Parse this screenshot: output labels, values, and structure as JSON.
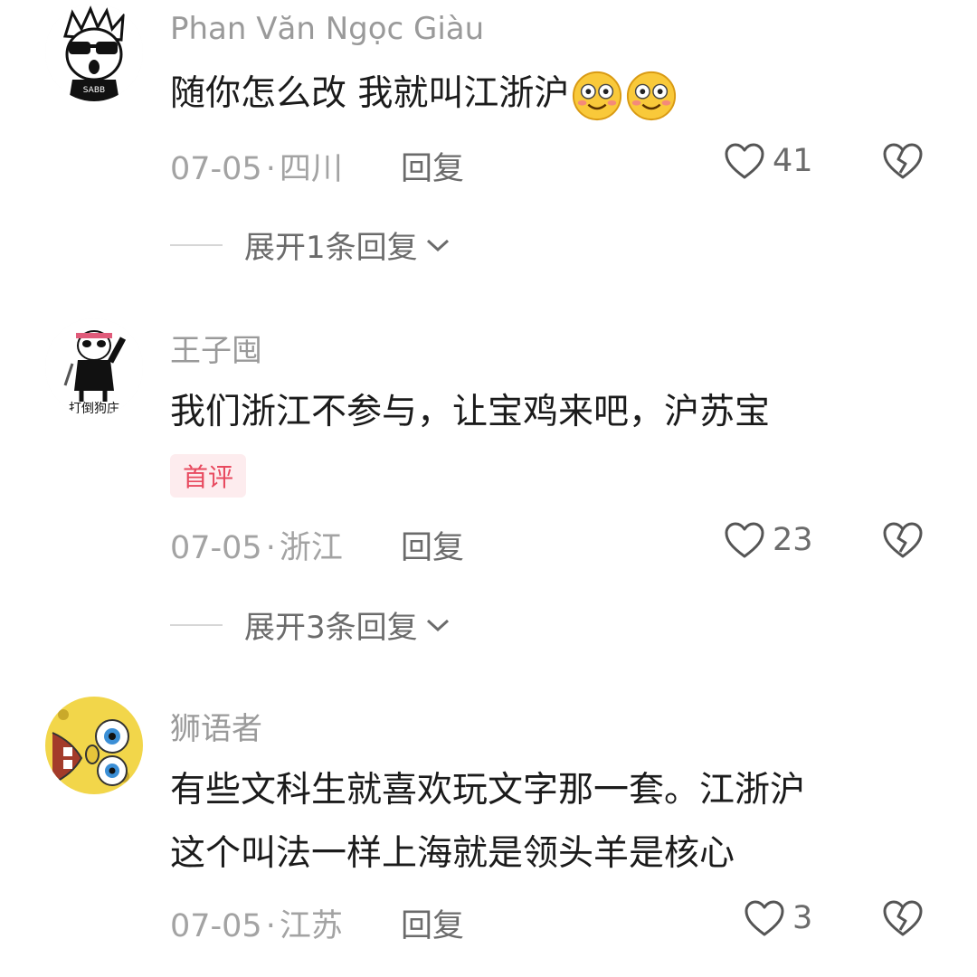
{
  "comments": [
    {
      "username": "Phan Văn Ngọc Giàu",
      "text": "随你怎么改 我就叫江浙沪",
      "emoji_count": 2,
      "emoji_icon": "smile-blush-emoji-icon",
      "date": "07-05",
      "location": "四川",
      "reply_label": "回复",
      "likes": "41",
      "expand_label": "展开1条回复"
    },
    {
      "username": "王子囤",
      "text": "我们浙江不参与，让宝鸡来吧，沪苏宝",
      "badge": "首评",
      "date": "07-05",
      "location": "浙江",
      "reply_label": "回复",
      "likes": "23",
      "expand_label": "展开3条回复"
    },
    {
      "username": "狮语者",
      "text_line1": "有些文科生就喜欢玩文字那一套。江浙沪",
      "text_line2": "这个叫法一样上海就是领头羊是核心",
      "date": "07-05",
      "location": "江苏",
      "reply_label": "回复",
      "likes": "3"
    }
  ],
  "separator": "·",
  "colors": {
    "username": "#9a9a9a",
    "badge_bg": "#fdecee",
    "badge_text": "#e84a5f",
    "meta": "#a3a3a3"
  }
}
